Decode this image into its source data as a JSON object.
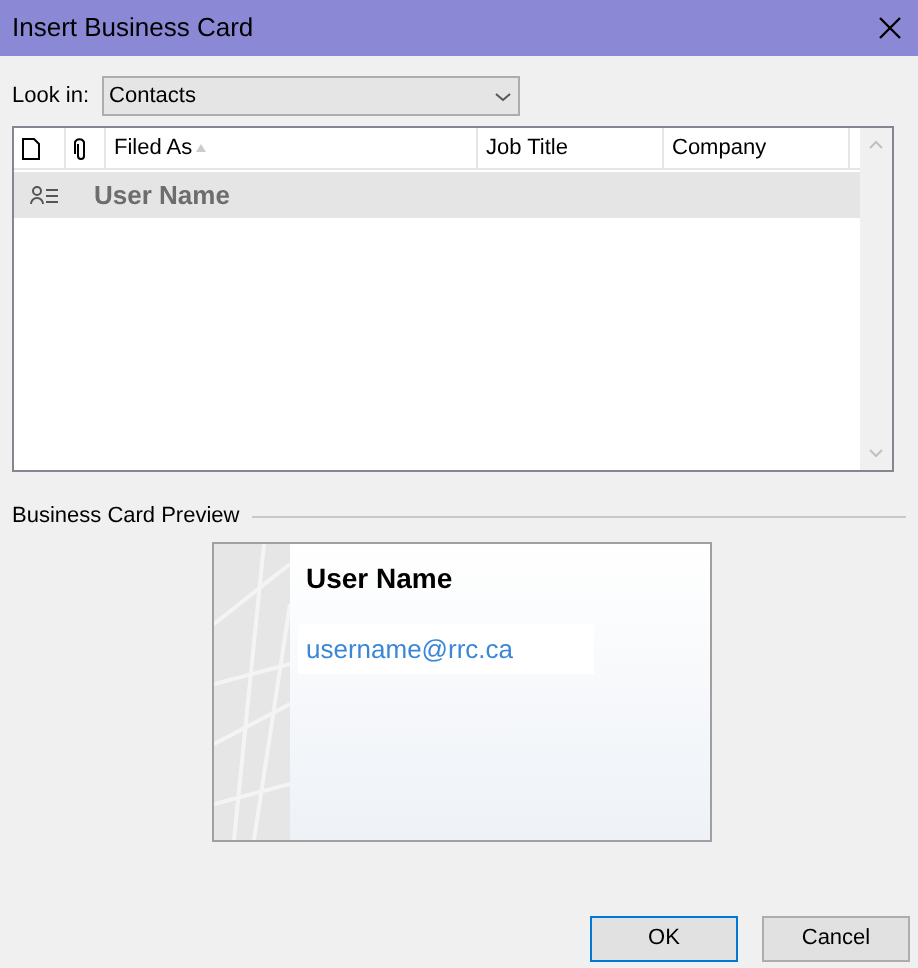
{
  "window": {
    "title": "Insert Business Card"
  },
  "look_in": {
    "label": "Look in:",
    "value": "Contacts"
  },
  "table": {
    "columns": [
      {
        "kind": "icon-doc"
      },
      {
        "kind": "icon-clip"
      },
      {
        "kind": "text",
        "label": "Filed As",
        "sorted": true
      },
      {
        "kind": "text",
        "label": "Job Title",
        "sorted": false
      },
      {
        "kind": "text",
        "label": "Company",
        "sorted": false
      }
    ],
    "rows": [
      {
        "filed_as": "User Name",
        "selected": true
      }
    ]
  },
  "preview": {
    "label": "Business Card Preview",
    "name": "User Name",
    "email": "username@rrc.ca"
  },
  "buttons": [
    {
      "label": "OK",
      "default": true
    },
    {
      "label": "Cancel",
      "default": false
    }
  ]
}
